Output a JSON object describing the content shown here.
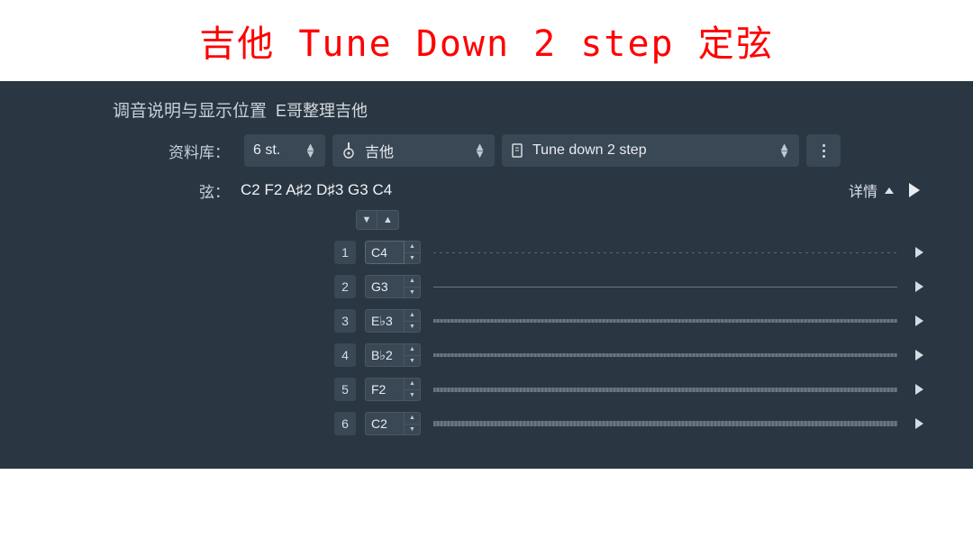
{
  "title": "吉他 Tune Down 2  step 定弦",
  "header": {
    "label": "调音说明与显示位置",
    "sub": "E哥整理吉他"
  },
  "library": {
    "label": "资料库：",
    "strings": "6 st.",
    "instrument": "吉他",
    "tuning": "Tune down 2 step"
  },
  "stringsRow": {
    "label": "弦：",
    "notes": "C2 F2 A♯2 D♯3 G3 C4",
    "detail": "详情"
  },
  "strings": [
    {
      "num": "1",
      "note": "C4",
      "style": "dotted",
      "active": true
    },
    {
      "num": "2",
      "note": "G3",
      "style": "thin",
      "active": false
    },
    {
      "num": "3",
      "note": "E♭3",
      "style": "textured",
      "active": false
    },
    {
      "num": "4",
      "note": "B♭2",
      "style": "textured",
      "active": false
    },
    {
      "num": "5",
      "note": "F2",
      "style": "textured2",
      "active": false
    },
    {
      "num": "6",
      "note": "C2",
      "style": "textured3",
      "active": false
    }
  ]
}
